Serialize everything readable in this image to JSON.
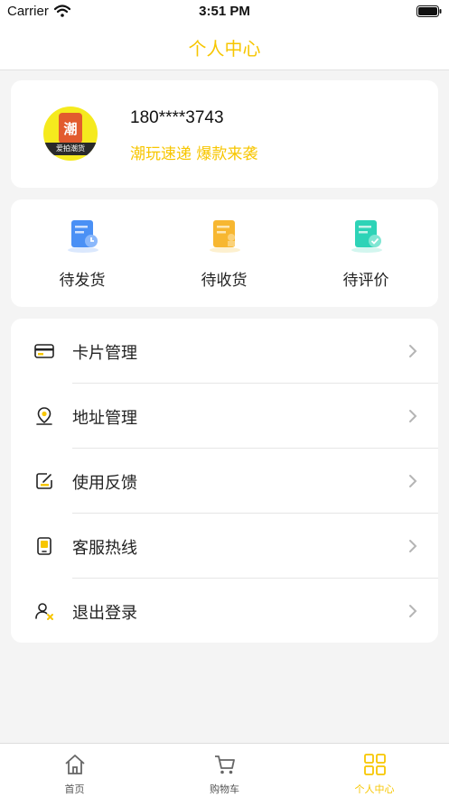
{
  "status_bar": {
    "carrier": "Carrier",
    "time": "3:51 PM"
  },
  "nav": {
    "title": "个人中心"
  },
  "profile": {
    "phone": "180****3743",
    "slogan": "潮玩速递 爆款来袭",
    "avatar_char": "潮",
    "avatar_caption": "爱拍潮货"
  },
  "orders": [
    {
      "label": "待发货",
      "icon": "pending-shipment-icon",
      "color": "#4a90f5"
    },
    {
      "label": "待收货",
      "icon": "pending-receipt-icon",
      "color": "#f7b731"
    },
    {
      "label": "待评价",
      "icon": "pending-review-icon",
      "color": "#2ed3b7"
    }
  ],
  "menu": [
    {
      "label": "卡片管理",
      "icon": "card-icon"
    },
    {
      "label": "地址管理",
      "icon": "location-icon"
    },
    {
      "label": "使用反馈",
      "icon": "feedback-icon"
    },
    {
      "label": "客服热线",
      "icon": "hotline-icon"
    },
    {
      "label": "退出登录",
      "icon": "logout-icon"
    }
  ],
  "tabs": [
    {
      "label": "首页",
      "icon": "home-icon",
      "active": false
    },
    {
      "label": "购物车",
      "icon": "cart-icon",
      "active": false
    },
    {
      "label": "个人中心",
      "icon": "grid-icon",
      "active": true
    }
  ],
  "colors": {
    "accent": "#f7c600",
    "background": "#f4f4f4"
  }
}
